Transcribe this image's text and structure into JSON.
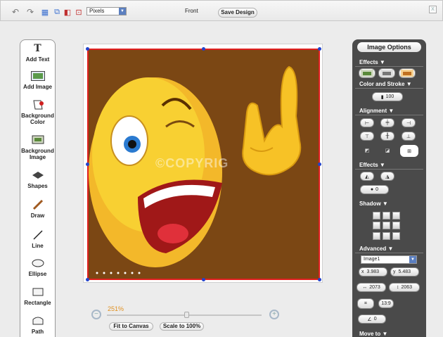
{
  "topbar": {
    "undo_icon": "undo-icon",
    "redo_icon": "redo-icon",
    "grid_icon": "grid-icon",
    "copy_icon": "copy-icon",
    "layers_icon": "layers-icon",
    "preview_icon": "preview-icon",
    "units_value": "Pixels",
    "side_label": "Front",
    "save_label": "Save Design",
    "close_label": "X"
  },
  "tools": [
    {
      "label": "Add Text",
      "icon": "text-icon"
    },
    {
      "label": "Add Image",
      "icon": "image-icon"
    },
    {
      "label": "Background Color",
      "icon": "background-color-icon"
    },
    {
      "label": "Background Image",
      "icon": "background-image-icon"
    },
    {
      "label": "Shapes",
      "icon": "shapes-icon"
    },
    {
      "label": "Draw",
      "icon": "pencil-icon"
    },
    {
      "label": "Line",
      "icon": "line-icon"
    },
    {
      "label": "Ellipse",
      "icon": "ellipse-icon"
    },
    {
      "label": "Rectangle",
      "icon": "rectangle-icon"
    },
    {
      "label": "Path",
      "icon": "path-icon"
    }
  ],
  "canvas": {
    "watermark": "©COPYRIG",
    "artwork_colors": {
      "background": "#7b4714",
      "face": "#f5c518",
      "selection": "#e02020"
    }
  },
  "zoom": {
    "percent": "251%",
    "level": 0.5,
    "fit_label": "Fit to Canvas",
    "scale_label": "Scale to 100%"
  },
  "panel": {
    "title": "Image Options",
    "effects_label": "Effects",
    "color_stroke_label": "Color and Stroke",
    "stroke_value": "100",
    "alignment_label": "Alignment",
    "effects2_label": "Effects",
    "blur_value": "0",
    "shadow_label": "Shadow",
    "advanced_label": "Advanced",
    "image_name": "Image1",
    "x_label": "x",
    "x_value": "3.983",
    "y_label": "y",
    "y_value": "5.483",
    "width_value": "2073",
    "height_value": "2063",
    "ratio_label": "13:9",
    "angle_value": "0",
    "move_to_label": "Move to"
  }
}
